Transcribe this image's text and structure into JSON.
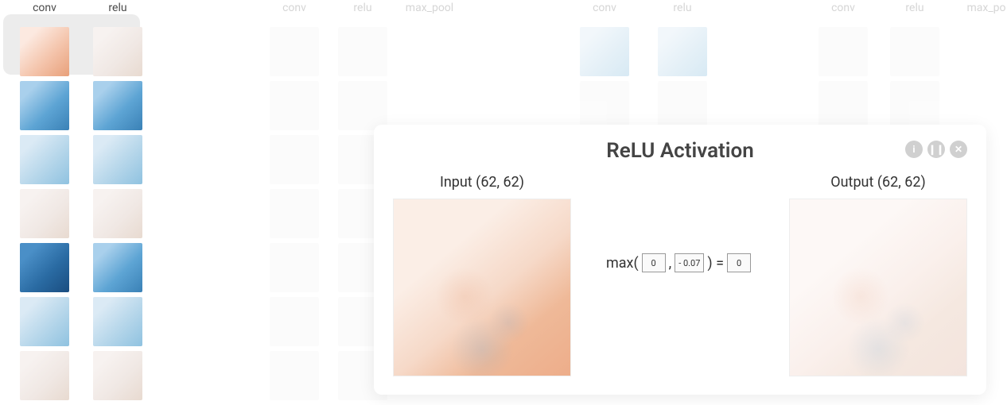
{
  "columns": {
    "col1": "conv",
    "col2": "relu",
    "col3": "conv",
    "col4": "relu",
    "col5": "max_pool",
    "col6": "conv",
    "col7": "relu",
    "col8": "conv",
    "col9": "relu",
    "col10": "max_po"
  },
  "modal": {
    "title": "ReLU Activation",
    "input_label": "Input (62, 62)",
    "output_label": "Output (62, 62)",
    "formula_prefix": "max(",
    "formula_arg1": "0",
    "formula_comma": ",",
    "formula_arg2": "- 0.07",
    "formula_close": ") =",
    "formula_result": "0"
  }
}
